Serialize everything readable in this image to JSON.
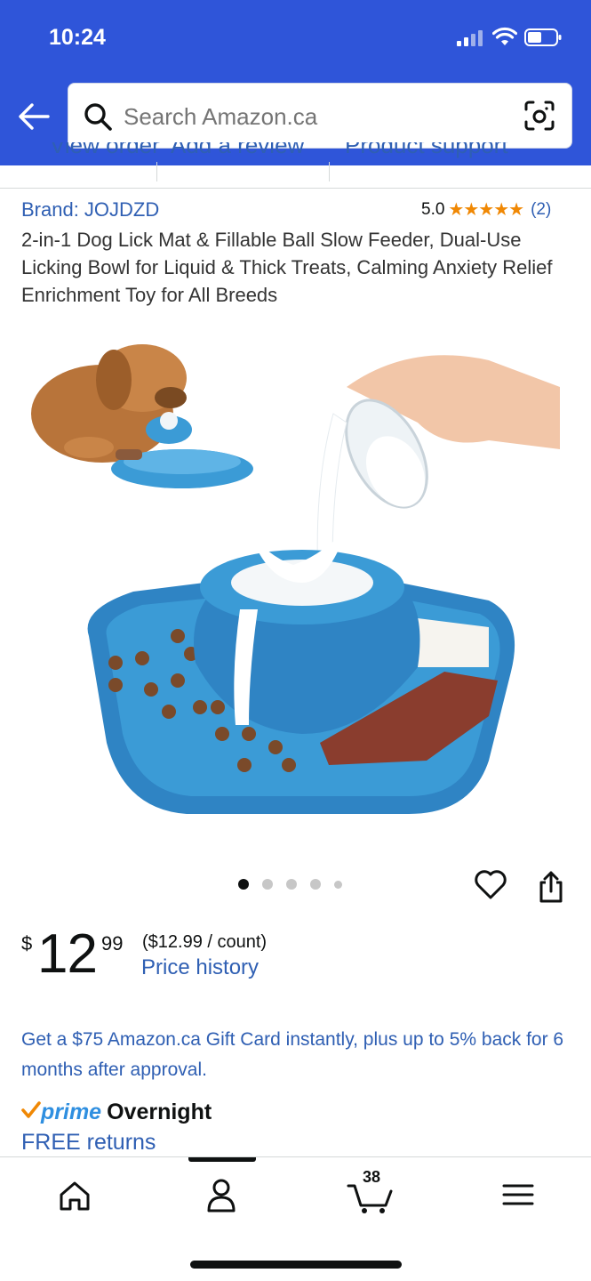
{
  "status_bar": {
    "time": "10:24"
  },
  "search": {
    "placeholder": "Search Amazon.ca"
  },
  "order_tabs": [
    "View order",
    "Add a review",
    "Product support"
  ],
  "product": {
    "brand": "Brand: JOJDZD",
    "rating_value": "5.0",
    "rating_stars": "★★★★★",
    "rating_count": "(2)",
    "title": "2-in-1 Dog Lick Mat & Fillable Ball Slow Feeder, Dual-Use Licking Bowl for Liquid & Thick Treats, Calming Anxiety Relief Enrichment Toy for All Breeds",
    "image_count": 5,
    "active_image": 1
  },
  "price": {
    "symbol": "$",
    "whole": "12",
    "fraction": "99",
    "unit": "($12.99 / count)",
    "history_link": "Price history"
  },
  "promo": "Get a $75 Amazon.ca Gift Card instantly, plus up to 5% back for 6 months after approval.",
  "delivery": {
    "prime": "prime",
    "overnight": "Overnight",
    "free_returns": "FREE returns"
  },
  "bottom_nav": {
    "cart_count": "38"
  },
  "colors": {
    "header": "#2f55d9",
    "link": "#2f5fb3",
    "star": "#f08804",
    "product_blue": "#3b9bd6"
  }
}
